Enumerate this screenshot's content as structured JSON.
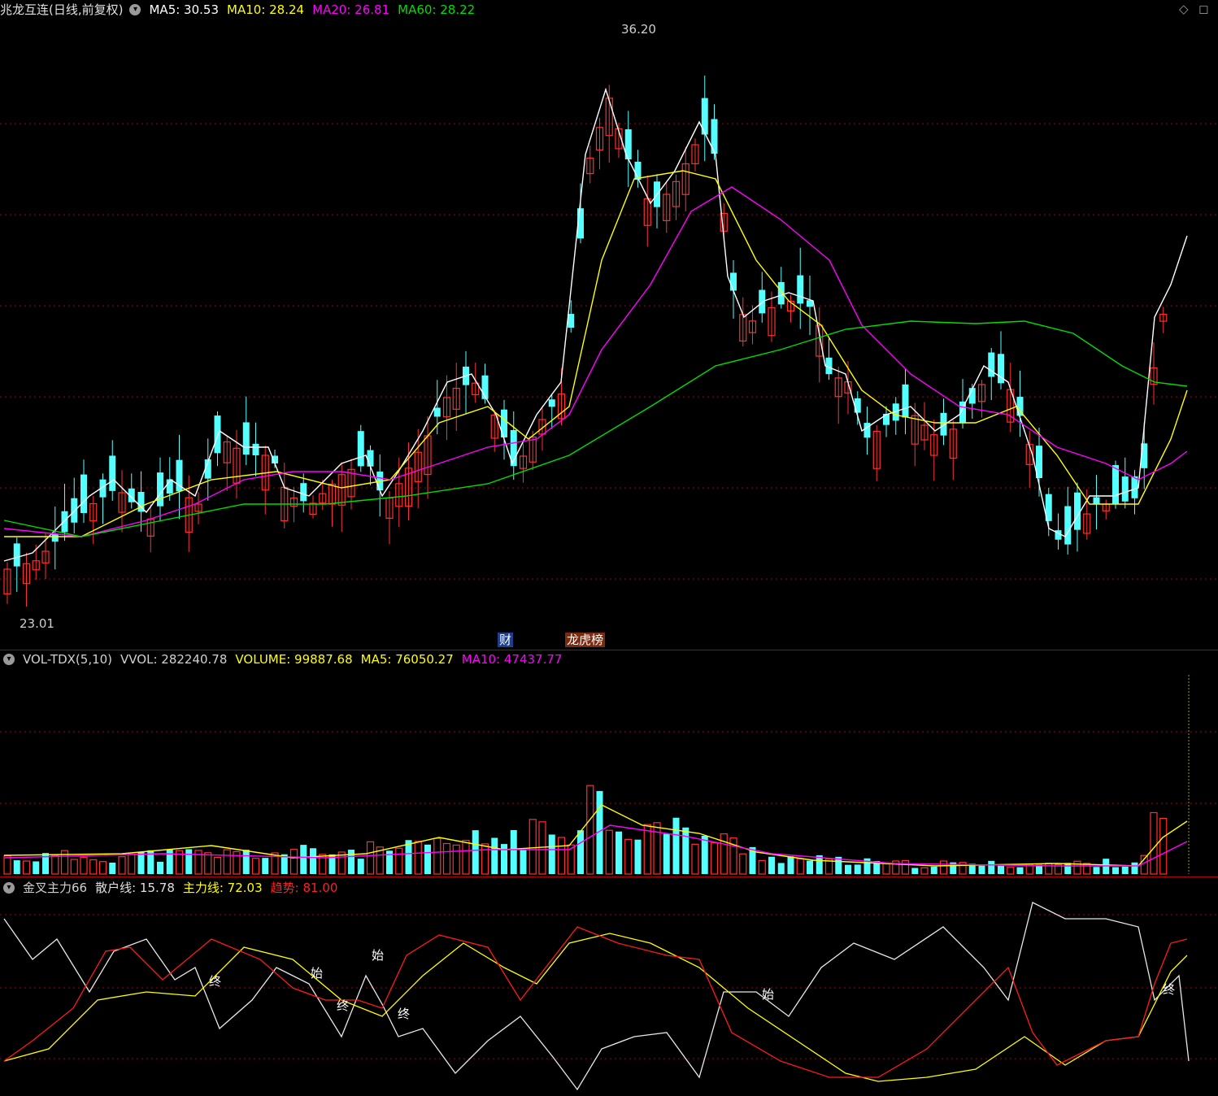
{
  "main_header": {
    "title": "兆龙互连(日线,前复权)",
    "ma5_label": "MA5: 30.53",
    "ma10_label": "MA10: 28.24",
    "ma20_label": "MA20: 26.81",
    "ma60_label": "MA60: 28.22"
  },
  "price_marks": {
    "high": "36.20",
    "low": "23.01"
  },
  "event_tags": {
    "finance": "财",
    "billboard": "龙虎榜"
  },
  "volume_header": {
    "name": "VOL-TDX(5,10)",
    "vvol": "VVOL: 282240.78",
    "volume": "VOLUME: 99887.68",
    "ma5": "MA5: 76050.27",
    "ma10": "MA10: 47437.77"
  },
  "indicator_header": {
    "name": "金叉主力66",
    "retail": "散户线: 15.78",
    "main_force": "主力线: 72.03",
    "trend": "趋势: 81.00"
  },
  "indicator_marks": [
    "终",
    "始",
    "始",
    "终",
    "终",
    "始",
    "终"
  ],
  "colors": {
    "up": "#ff3030",
    "down": "#54ffff",
    "ma5": "#ffffff",
    "ma10": "#ffff00",
    "ma20": "#ff00ff",
    "ma60": "#00dd00",
    "grid": "#a00000"
  },
  "chart_data": [
    {
      "type": "candlestick",
      "price_range": [
        23.01,
        36.2
      ],
      "series": [
        {
          "name": "MA5",
          "last": 30.53
        },
        {
          "name": "MA10",
          "last": 28.24
        },
        {
          "name": "MA20",
          "last": 26.81
        },
        {
          "name": "MA60",
          "last": 28.22
        }
      ]
    },
    {
      "type": "bar",
      "series": [
        {
          "name": "VOLUME",
          "last": 99887.68
        },
        {
          "name": "MA5",
          "last": 76050.27
        },
        {
          "name": "MA10",
          "last": 47437.77
        }
      ]
    },
    {
      "type": "line",
      "series": [
        {
          "name": "散户线",
          "last": 15.78
        },
        {
          "name": "主力线",
          "last": 72.03
        },
        {
          "name": "趋势",
          "last": 81.0
        }
      ]
    }
  ]
}
